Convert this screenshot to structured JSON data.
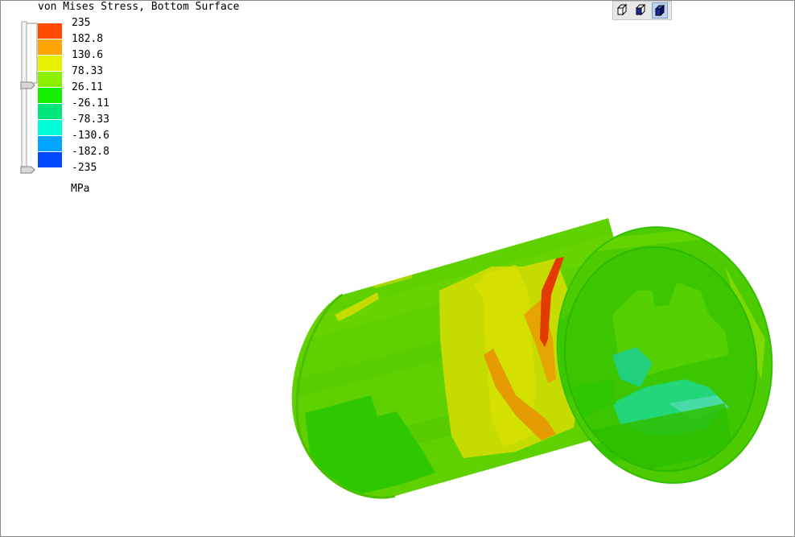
{
  "plot": {
    "title": "von Mises Stress, Bottom Surface",
    "units": "MPa"
  },
  "legend": {
    "labels": [
      "235",
      "182.8",
      "130.6",
      "78.33",
      "26.11",
      "-26.11",
      "-78.33",
      "-130.6",
      "-182.8",
      "-235"
    ],
    "colors": [
      "#ff4a00",
      "#ffa500",
      "#e6f000",
      "#8cf000",
      "#14f000",
      "#00e67a",
      "#00ffd9",
      "#00a5ff",
      "#0048ff"
    ]
  },
  "toolbar": {
    "buttons": [
      {
        "name": "wireframe-view-icon",
        "active": false
      },
      {
        "name": "solid-view-icon",
        "active": false
      },
      {
        "name": "shaded-view-icon",
        "active": true
      }
    ]
  },
  "colors": {
    "main_green": "#5fd100",
    "dark_green": "#2fc800",
    "yellow_green": "#c6dc00",
    "orange": "#e49a00",
    "red": "#e23a00",
    "teal": "#22d67a"
  }
}
